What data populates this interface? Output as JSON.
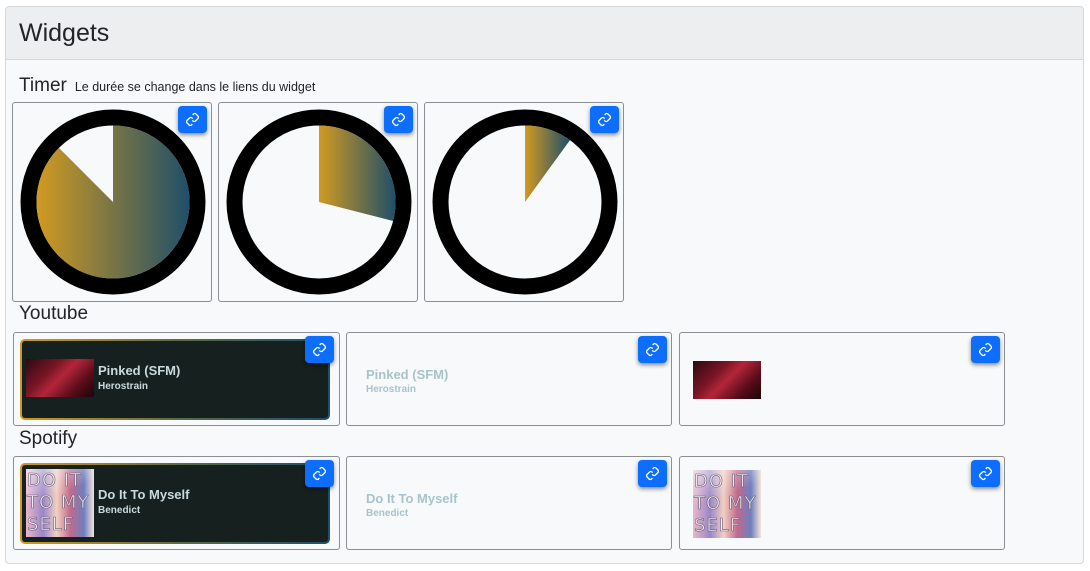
{
  "header": {
    "title": "Widgets"
  },
  "timer": {
    "title": "Timer",
    "note": "Le durée se change dans le liens du widget",
    "widgets": [
      {
        "remaining_fraction": 0.875
      },
      {
        "remaining_fraction": 0.29
      },
      {
        "remaining_fraction": 0.1
      }
    ]
  },
  "youtube": {
    "title": "Youtube",
    "widgets": [
      {
        "style": "card",
        "title": "Pinked (SFM)",
        "artist": "Herostrain"
      },
      {
        "style": "text",
        "title": "Pinked (SFM)",
        "artist": "Herostrain"
      },
      {
        "style": "thumbnail"
      }
    ]
  },
  "spotify": {
    "title": "Spotify",
    "widgets": [
      {
        "style": "card",
        "title": "Do It To Myself",
        "artist": "Benedict"
      },
      {
        "style": "text",
        "title": "Do It To Myself",
        "artist": "Benedict"
      },
      {
        "style": "thumbnail"
      }
    ],
    "cover_text": [
      "DO IT",
      "TO MY",
      "SELF"
    ]
  },
  "icons": {
    "widget_link": "link-icon"
  },
  "colors": {
    "accent": "#0d6efd",
    "gradient_start": "#d19a22",
    "gradient_end": "#1f4f69",
    "ring": "#000000"
  }
}
